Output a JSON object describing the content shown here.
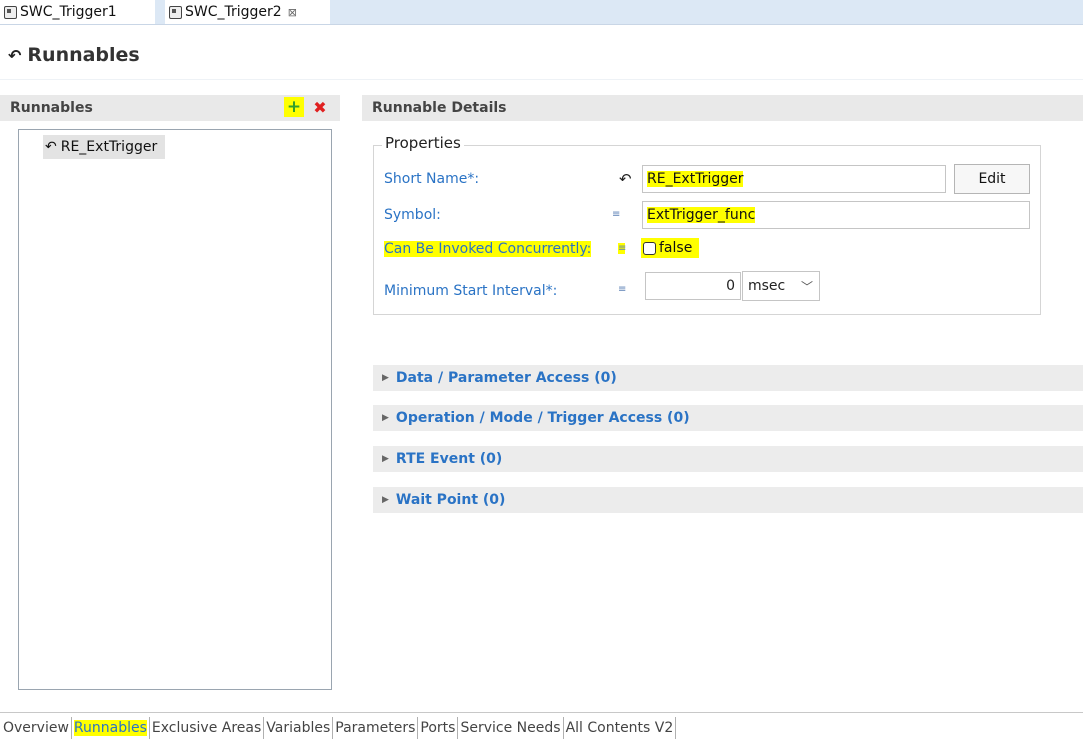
{
  "tabs": [
    {
      "label": "SWC_Trigger1",
      "icon": "component-icon"
    },
    {
      "label": "SWC_Trigger2",
      "icon": "component-icon",
      "close": "⊠"
    }
  ],
  "page": {
    "title": "Runnables",
    "icon": "runnable-icon"
  },
  "runnables_panel": {
    "title": "Runnables",
    "add_icon": "+",
    "delete_icon": "✖",
    "items": [
      "RE_ExtTrigger"
    ]
  },
  "details": {
    "title": "Runnable Details",
    "properties_legend": "Properties",
    "short_name_label": "Short Name*:",
    "short_name_value": "RE_ExtTrigger",
    "edit_label": "Edit",
    "symbol_label": "Symbol:",
    "symbol_value": "ExtTrigger_func",
    "concurrent_label": "Can Be Invoked Concurrently:",
    "concurrent_value": "false",
    "interval_label": "Minimum Start Interval*:",
    "interval_value": "0",
    "interval_unit": "msec",
    "mini_icon": "≡"
  },
  "sections": [
    "Data / Parameter Access (0)",
    "Operation / Mode / Trigger Access (0)",
    "RTE Event (0)",
    "Wait Point (0)"
  ],
  "bottom_tabs": [
    "Overview",
    "Runnables",
    "Exclusive Areas",
    "Variables",
    "Parameters",
    "Ports",
    "Service Needs",
    "All Contents V2"
  ],
  "colors": {
    "highlight": "#ffff00",
    "link": "#2a73c5",
    "tabbar": "#dce8f5"
  }
}
